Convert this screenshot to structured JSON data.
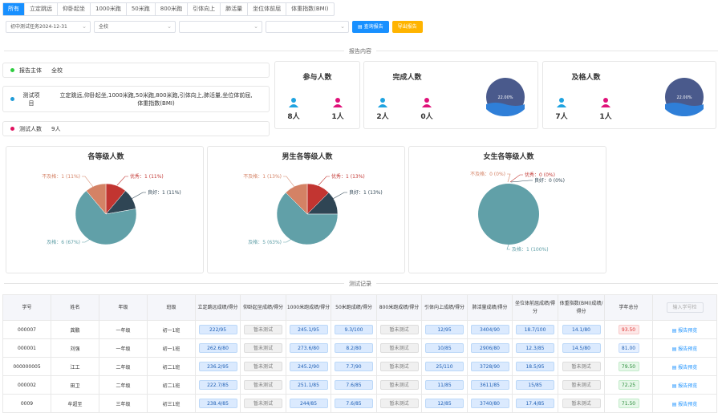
{
  "tabs": [
    "所有",
    "立定跳远",
    "仰卧起坐",
    "1000米跑",
    "50米跑",
    "800米跑",
    "引体向上",
    "肺活量",
    "坐位体前屈",
    "体重指数(BMI)"
  ],
  "filters": {
    "task": "初中测试任务2024-12-31",
    "school": "全校",
    "query_btn": "查询报告",
    "export_btn": "导出报告"
  },
  "section_report": "报告内容",
  "section_records": "测试记录",
  "info": {
    "subject_label": "报告主体",
    "subject_value": "全校",
    "items_label_1": "测试项",
    "items_label_2": "目",
    "items_value_1": "立定跳远,仰卧起坐,1000米跑,50米跑,800米跑,引体向上,肺活量,坐位体前屈,",
    "items_value_2": "体重指数(BMI)",
    "count_label": "测试人数",
    "count_value": "9人",
    "colors": {
      "subject": "#2ecc40",
      "items": "#1f9bd7",
      "count": "#e0115f"
    }
  },
  "stats": {
    "participate": {
      "title": "参与人数",
      "male": "8人",
      "female": "1人"
    },
    "complete": {
      "title": "完成人数",
      "male": "2人",
      "female": "0人",
      "percent": "22.00%",
      "fill": 0.22
    },
    "pass": {
      "title": "及格人数",
      "male": "7人",
      "female": "1人",
      "percent": "22.00%",
      "fill": 0.22
    }
  },
  "chart_data": [
    {
      "type": "pie",
      "title": "各等级人数",
      "labels": [
        "优秀",
        "良好",
        "及格",
        "不及格"
      ],
      "values": [
        1,
        1,
        6,
        1
      ],
      "annotations": [
        "优秀：1 (11%)",
        "良好：1 (11%)",
        "及格：6 (67%)",
        "不及格：1 (11%)"
      ],
      "colors": [
        "#c23531",
        "#2f4554",
        "#61a0a8",
        "#d48265"
      ]
    },
    {
      "type": "pie",
      "title": "男生各等级人数",
      "labels": [
        "优秀",
        "良好",
        "及格",
        "不及格"
      ],
      "values": [
        1,
        1,
        5,
        1
      ],
      "annotations": [
        "优秀：1 (13%)",
        "良好：1 (13%)",
        "及格：5 (63%)",
        "不及格：1 (13%)"
      ],
      "colors": [
        "#c23531",
        "#2f4554",
        "#61a0a8",
        "#d48265"
      ]
    },
    {
      "type": "pie",
      "title": "女生各等级人数",
      "labels": [
        "优秀",
        "良好",
        "及格",
        "不及格"
      ],
      "values": [
        0,
        0,
        1,
        0
      ],
      "annotations": [
        "优秀：0 (0%)",
        "良好：0 (0%)",
        "及格：1 (100%)",
        "不及格：0 (0%)"
      ],
      "colors": [
        "#c23531",
        "#2f4554",
        "#61a0a8",
        "#d48265"
      ]
    }
  ],
  "table": {
    "headers": [
      "学号",
      "姓名",
      "年级",
      "班级",
      "立定跳远成绩/得分",
      "仰卧起坐成绩/得分",
      "1000米跑成绩/得分",
      "50米跑成绩/得分",
      "800米跑成绩/得分",
      "引体向上成绩/得分",
      "肺活量成绩/得分",
      "坐位体前屈成绩/得分",
      "体重指数(BMI)成绩/得分",
      "学年总分"
    ],
    "search_placeholder": "输入学号检",
    "link_label": "报告预览",
    "rows": [
      {
        "id": "000007",
        "name": "龚鹏",
        "grade": "一年级",
        "class": "初一1班",
        "cells": [
          "222/95",
          "暂未测试",
          "245.1/95",
          "9.3/100",
          "暂未测试",
          "12/95",
          "3404/90",
          "18.7/100",
          "14.1/80"
        ],
        "total": "93.50",
        "tone": "red"
      },
      {
        "id": "000001",
        "name": "刘强",
        "grade": "一年级",
        "class": "初一1班",
        "cells": [
          "262.6/80",
          "暂未测试",
          "273.6/80",
          "8.2/80",
          "暂未测试",
          "10/85",
          "2906/80",
          "12.3/85",
          "14.5/80"
        ],
        "total": "81.00",
        "tone": "blue"
      },
      {
        "id": "000000005",
        "name": "江工",
        "grade": "二年级",
        "class": "初二1班",
        "cells": [
          "236.2/95",
          "暂未测试",
          "245.2/90",
          "7.7/90",
          "暂未测试",
          "25/110",
          "3728/90",
          "18.5/95",
          "暂未测试"
        ],
        "total": "79.50",
        "tone": "green"
      },
      {
        "id": "000002",
        "name": "田卫",
        "grade": "二年级",
        "class": "初二1班",
        "cells": [
          "222.7/85",
          "暂未测试",
          "251.1/85",
          "7.6/85",
          "暂未测试",
          "11/85",
          "3611/85",
          "15/85",
          "暂未测试"
        ],
        "total": "72.25",
        "tone": "green"
      },
      {
        "id": "0009",
        "name": "牟超至",
        "grade": "三年级",
        "class": "初三1班",
        "cells": [
          "238.4/85",
          "暂未测试",
          "244/85",
          "7.6/85",
          "暂未测试",
          "12/85",
          "3740/80",
          "17.4/85",
          "暂未测试"
        ],
        "total": "71.50",
        "tone": "green"
      }
    ]
  }
}
